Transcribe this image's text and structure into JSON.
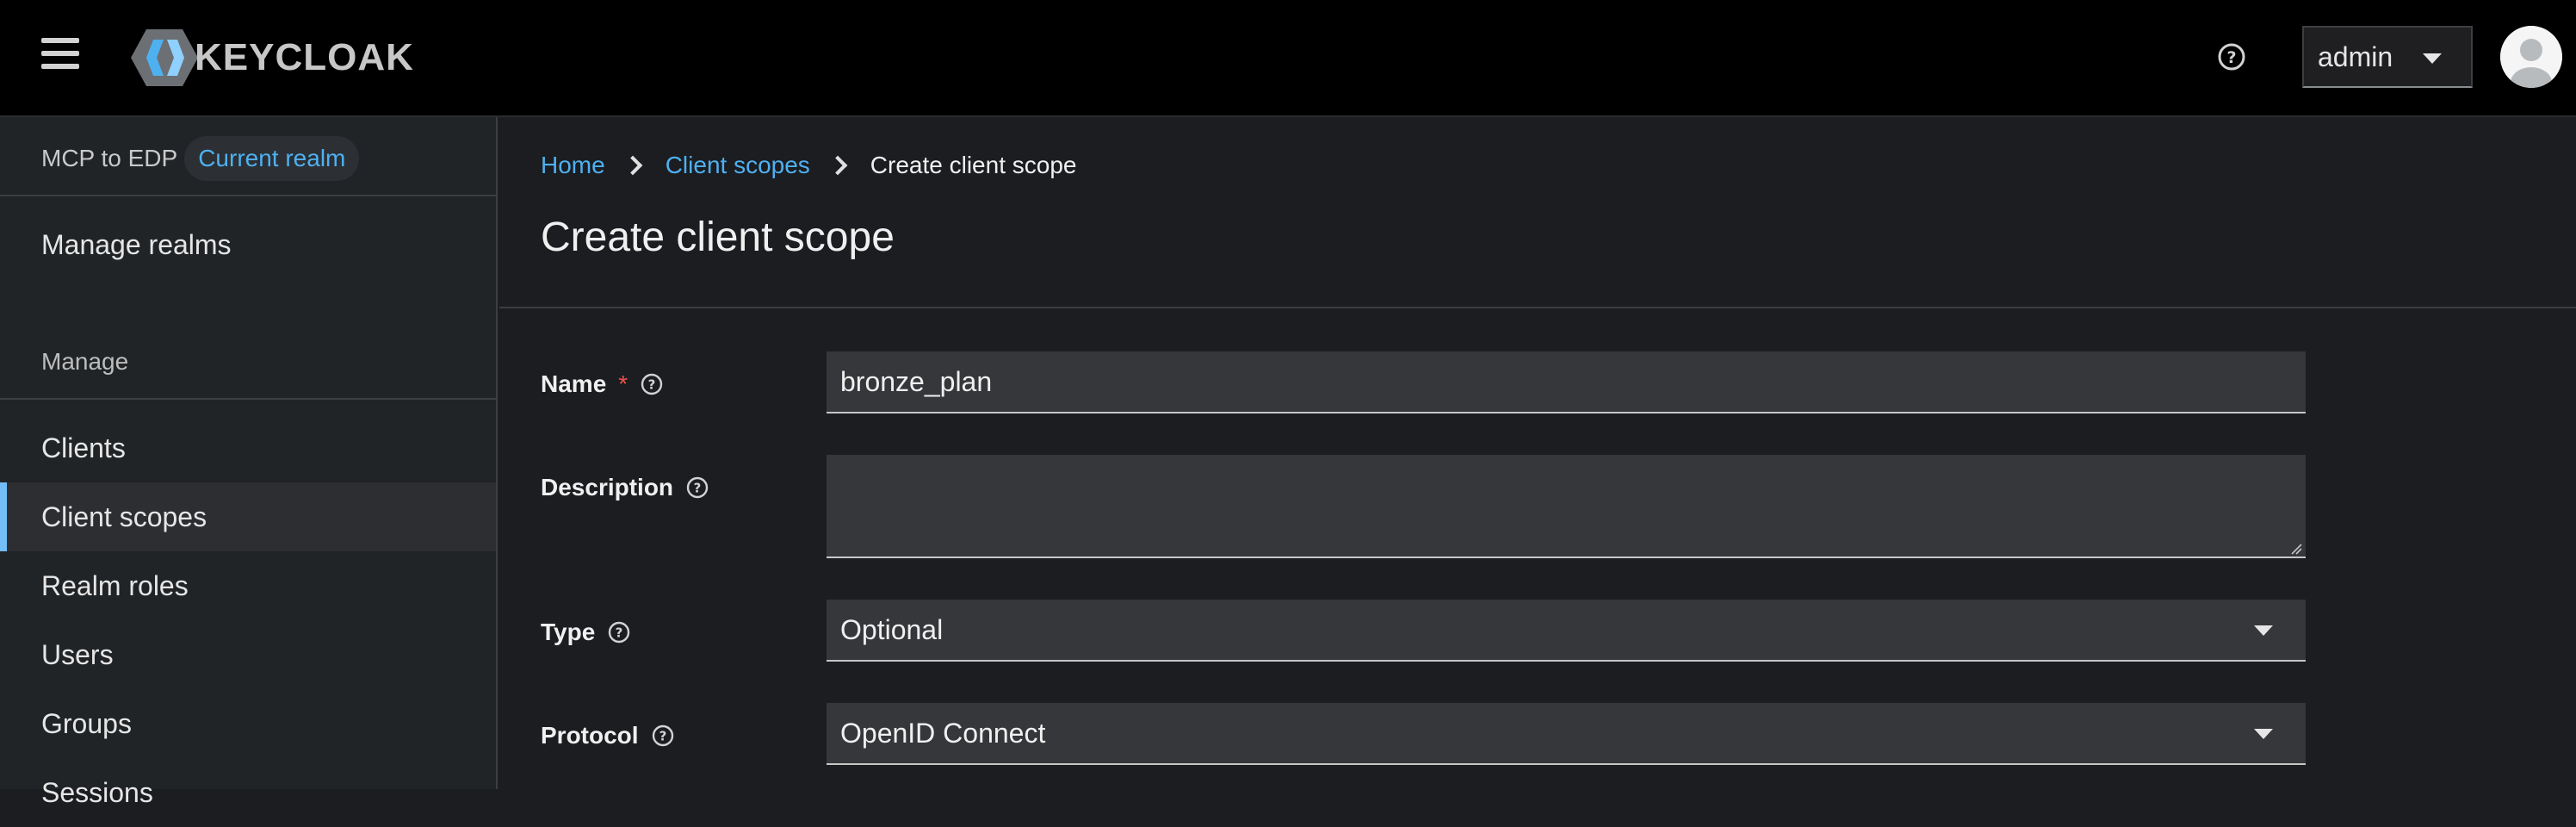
{
  "header": {
    "brand": "KEYCLOAK",
    "user_menu": "admin"
  },
  "sidebar": {
    "realm_name": "MCP to EDP",
    "realm_badge": "Current realm",
    "manage_realms": "Manage realms",
    "section_title": "Manage",
    "items": [
      {
        "label": "Clients",
        "active": false
      },
      {
        "label": "Client scopes",
        "active": true
      },
      {
        "label": "Realm roles",
        "active": false
      },
      {
        "label": "Users",
        "active": false
      },
      {
        "label": "Groups",
        "active": false
      },
      {
        "label": "Sessions",
        "active": false
      }
    ]
  },
  "breadcrumb": {
    "home": "Home",
    "client_scopes": "Client scopes",
    "current": "Create client scope"
  },
  "page_title": "Create client scope",
  "form": {
    "name": {
      "label": "Name",
      "required_mark": "*",
      "value": "bronze_plan"
    },
    "description": {
      "label": "Description",
      "value": ""
    },
    "type": {
      "label": "Type",
      "value": "Optional"
    },
    "protocol": {
      "label": "Protocol",
      "value": "OpenID Connect"
    }
  },
  "colors": {
    "link": "#4fb0f0",
    "active_indicator": "#73bcf7",
    "required": "#f0524e"
  }
}
